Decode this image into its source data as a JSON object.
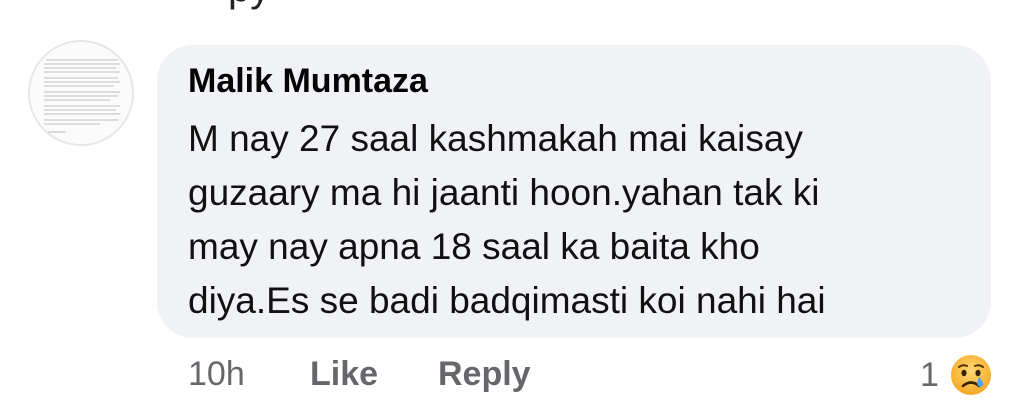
{
  "comment": {
    "author": "Malik Mumtaza",
    "text_lines": [
      "M nay 27 saal kashmakah mai kaisay",
      "guzaary ma hi jaanti hoon.yahan tak ki",
      "may nay apna 18 saal ka baita kho",
      "diya.Es se badi badqimasti koi nahi hai"
    ]
  },
  "actions": {
    "time": "10h",
    "like": "Like",
    "reply": "Reply"
  },
  "reactions": {
    "count": "1",
    "emoji_icon": "crying-face-icon"
  },
  "colors": {
    "bubble": "#f0f2f5",
    "secondary_text": "#65676b",
    "primary_text": "#050505"
  }
}
